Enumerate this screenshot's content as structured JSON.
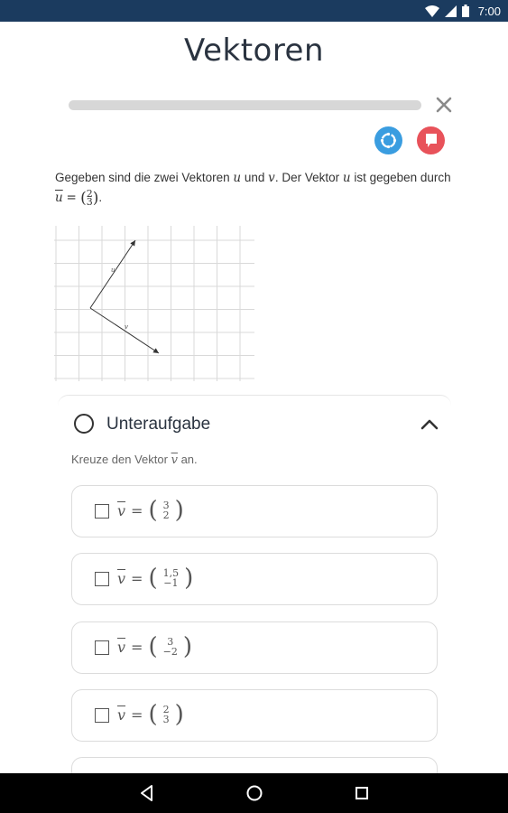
{
  "status_bar": {
    "time": "7:00",
    "icons": [
      "wifi-icon",
      "signal-icon",
      "battery-icon"
    ]
  },
  "page": {
    "title": "Vektoren"
  },
  "progress": {
    "fraction": 0.0
  },
  "actions": {
    "sync_icon": "sync-icon",
    "flag_icon": "flag-icon",
    "close_icon": "close-icon"
  },
  "question": {
    "text_1": "Gegeben sind die zwei Vektoren",
    "u": "u",
    "text_and": "und",
    "v": "v",
    "text_2": ". Der Vektor",
    "text_3": "ist gegeben durch",
    "u_vec_label": "u",
    "u_vec": [
      "2",
      "3"
    ]
  },
  "figure": {
    "grid_lines": 9,
    "label_u": "u",
    "label_v": "v"
  },
  "subtask": {
    "title": "Unteraufgabe",
    "instruction_text": "Kreuze den Vektor",
    "instruction_var": "v",
    "instruction_suffix": "an."
  },
  "options": [
    {
      "var": "v",
      "top": "3",
      "bottom": "2"
    },
    {
      "var": "v",
      "top": "1,5",
      "bottom": "−1"
    },
    {
      "var": "v",
      "top": "3",
      "bottom": "−2"
    },
    {
      "var": "v",
      "top": "2",
      "bottom": "3"
    }
  ],
  "nav": {
    "back_icon": "back-icon",
    "home_icon": "home-icon",
    "recents_icon": "recents-icon"
  },
  "colors": {
    "status_bar": "#1b3b5f",
    "sync": "#3a9de0",
    "flag": "#e8525a"
  }
}
